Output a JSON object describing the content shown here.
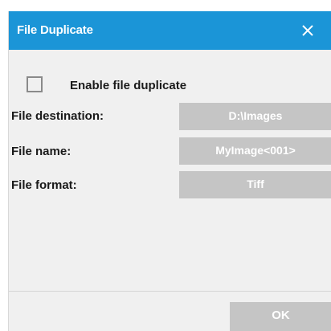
{
  "dialog": {
    "title": "File Duplicate",
    "close_icon": "close-icon"
  },
  "enable": {
    "label": "Enable file duplicate",
    "checked": false
  },
  "fields": [
    {
      "label": "File destination:",
      "value": "D:\\Images"
    },
    {
      "label": "File name:",
      "value": "MyImage<001>"
    },
    {
      "label": "File format:",
      "value": "Tiff"
    }
  ],
  "footer": {
    "ok_label": "OK"
  },
  "colors": {
    "titlebar": "#1b95d7",
    "dialog_bg": "#f0f0f0",
    "field_bg": "#c5c5c5"
  }
}
